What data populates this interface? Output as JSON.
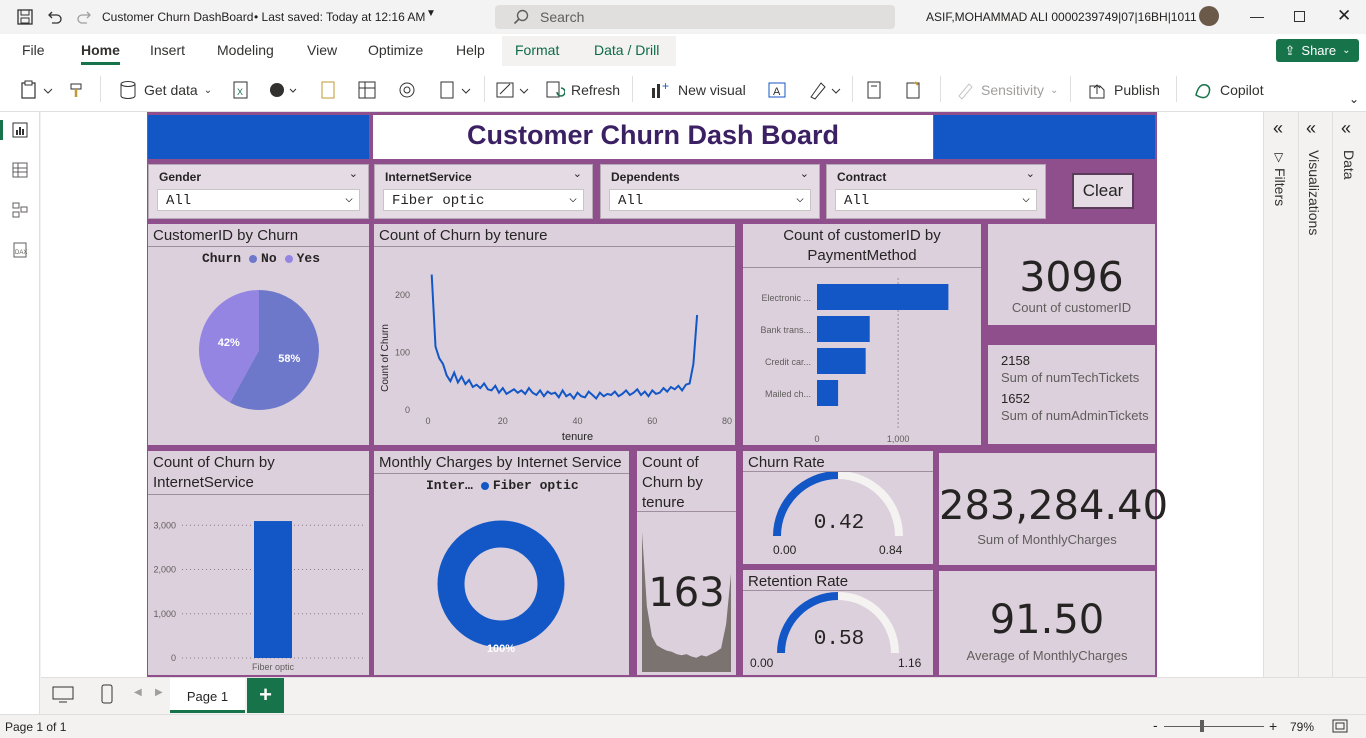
{
  "titlebar": {
    "title": "Customer Churn DashBoard",
    "saved": "• Last saved: Today at 12:16 AM",
    "search_placeholder": "Search",
    "user": "ASIF,MOHAMMAD ALI 0000239749|07|16BH|1011"
  },
  "menu": {
    "items": [
      "File",
      "Home",
      "Insert",
      "Modeling",
      "View",
      "Optimize",
      "Help",
      "Format",
      "Data / Drill"
    ],
    "active": "Home",
    "share_label": "Share"
  },
  "ribbon": {
    "get_data": "Get data",
    "refresh": "Refresh",
    "new_visual": "New visual",
    "sensitivity": "Sensitivity",
    "publish": "Publish",
    "copilot": "Copilot"
  },
  "report": {
    "title": "Customer Churn Dash Board",
    "slicers": [
      {
        "label": "Gender",
        "value": "All"
      },
      {
        "label": "InternetService",
        "value": "Fiber optic"
      },
      {
        "label": "Dependents",
        "value": "All"
      },
      {
        "label": "Contract",
        "value": "All"
      }
    ],
    "clear_label": "Clear",
    "pie": {
      "title": "CustomerID by Churn",
      "legend_title": "Churn",
      "legend": [
        "No",
        "Yes"
      ],
      "labels": [
        "58%",
        "42%"
      ],
      "colors": [
        "#6d78cb",
        "#9585e2"
      ]
    },
    "line": {
      "title": "Count of Churn by tenure",
      "xlabel": "tenure",
      "ylabel": "Count of Churn",
      "yticks": [
        "200",
        "100",
        "0"
      ],
      "xticks": [
        "0",
        "20",
        "40",
        "60",
        "80"
      ]
    },
    "hbar": {
      "title_line1": "Count of customerID by",
      "title_line2": "PaymentMethod",
      "categories": [
        "Electronic ...",
        "Bank trans...",
        "Credit car...",
        "Mailed ch..."
      ],
      "xticks": [
        "0",
        "1,000"
      ]
    },
    "kpi_count": {
      "value": "3096",
      "label": "Count of customerID"
    },
    "tickets": {
      "tech_value": "2158",
      "tech_label": "Sum of numTechTickets",
      "admin_value": "1652",
      "admin_label": "Sum of numAdminTickets"
    },
    "vbar": {
      "title_line1": "Count of Churn by",
      "title_line2": "InternetService",
      "yticks": [
        "3,000",
        "2,000",
        "1,000",
        "0"
      ],
      "category": "Fiber optic"
    },
    "donut": {
      "title": "Monthly Charges by Internet Service",
      "legend_title": "Inter…",
      "legend_item": "Fiber optic",
      "label": "100%"
    },
    "tenure_card": {
      "title_l1": "Count of",
      "title_l2": "Churn by",
      "title_l3": "tenure",
      "value": "163"
    },
    "churn_rate": {
      "title": "Churn Rate",
      "value": "0.42",
      "min": "0.00",
      "max": "0.84"
    },
    "retention_rate": {
      "title": "Retention Rate",
      "value": "0.58",
      "min": "0.00",
      "max": "1.16"
    },
    "monthly_sum": {
      "value": "283,284.40",
      "label": "Sum of MonthlyCharges"
    },
    "monthly_avg": {
      "value": "91.50",
      "label": "Average of MonthlyCharges"
    }
  },
  "panes": {
    "filters": "Filters",
    "visualizations": "Visualizations",
    "data": "Data"
  },
  "bottom": {
    "page_tab": "Page 1",
    "status": "Page 1 of 1",
    "zoom": "79%"
  },
  "colors": {
    "accent_blue": "#1357c6",
    "report_bg": "#8e4f8c",
    "tile_bg": "#dcd0dc",
    "brand_green": "#16734a"
  },
  "chart_data": [
    {
      "type": "pie",
      "title": "CustomerID by Churn",
      "categories": [
        "No",
        "Yes"
      ],
      "values": [
        58,
        42
      ]
    },
    {
      "type": "line",
      "title": "Count of Churn by tenure",
      "xlabel": "tenure",
      "ylabel": "Count of Churn",
      "xlim": [
        0,
        80
      ],
      "ylim": [
        0,
        250
      ],
      "x": [
        1,
        2,
        3,
        4,
        5,
        6,
        7,
        8,
        9,
        10,
        11,
        12,
        13,
        14,
        15,
        16,
        17,
        18,
        19,
        20,
        21,
        22,
        23,
        24,
        25,
        26,
        27,
        28,
        29,
        30,
        31,
        32,
        33,
        34,
        35,
        36,
        37,
        38,
        39,
        40,
        41,
        42,
        43,
        44,
        45,
        46,
        47,
        48,
        49,
        50,
        51,
        52,
        53,
        54,
        55,
        56,
        57,
        58,
        59,
        60,
        61,
        62,
        63,
        64,
        65,
        66,
        67,
        68,
        69,
        70,
        71,
        72
      ],
      "values": [
        235,
        110,
        90,
        80,
        60,
        50,
        65,
        48,
        58,
        45,
        52,
        40,
        44,
        38,
        46,
        36,
        34,
        42,
        30,
        38,
        28,
        32,
        36,
        30,
        34,
        28,
        38,
        30,
        26,
        34,
        24,
        32,
        28,
        30,
        22,
        34,
        24,
        28,
        20,
        30,
        24,
        22,
        32,
        26,
        20,
        30,
        24,
        28,
        26,
        32,
        24,
        28,
        34,
        26,
        30,
        36,
        26,
        32,
        24,
        34,
        28,
        30,
        38,
        32,
        40,
        36,
        42,
        34,
        44,
        46,
        80,
        165
      ]
    },
    {
      "type": "bar",
      "orientation": "horizontal",
      "title": "Count of customerID by PaymentMethod",
      "categories": [
        "Electronic ...",
        "Bank trans...",
        "Credit car...",
        "Mailed ch..."
      ],
      "values": [
        1620,
        650,
        600,
        260
      ],
      "xlim": [
        0,
        1800
      ]
    },
    {
      "type": "bar",
      "title": "Count of Churn by InternetService",
      "categories": [
        "Fiber optic"
      ],
      "values": [
        3096
      ],
      "ylim": [
        0,
        3300
      ]
    },
    {
      "type": "pie",
      "subtype": "donut",
      "title": "Monthly Charges by Internet Service",
      "categories": [
        "Fiber optic"
      ],
      "values": [
        100
      ]
    },
    {
      "type": "area",
      "title": "Count of Churn by tenure",
      "values": [
        235,
        110,
        60,
        45,
        40,
        36,
        34,
        30,
        28,
        30,
        26,
        24,
        28,
        26,
        30,
        34,
        40,
        80,
        165
      ]
    },
    {
      "type": "gauge",
      "title": "Churn Rate",
      "value": 0.42,
      "range": [
        0,
        0.84
      ]
    },
    {
      "type": "gauge",
      "title": "Retention Rate",
      "value": 0.58,
      "range": [
        0,
        1.16
      ]
    }
  ]
}
